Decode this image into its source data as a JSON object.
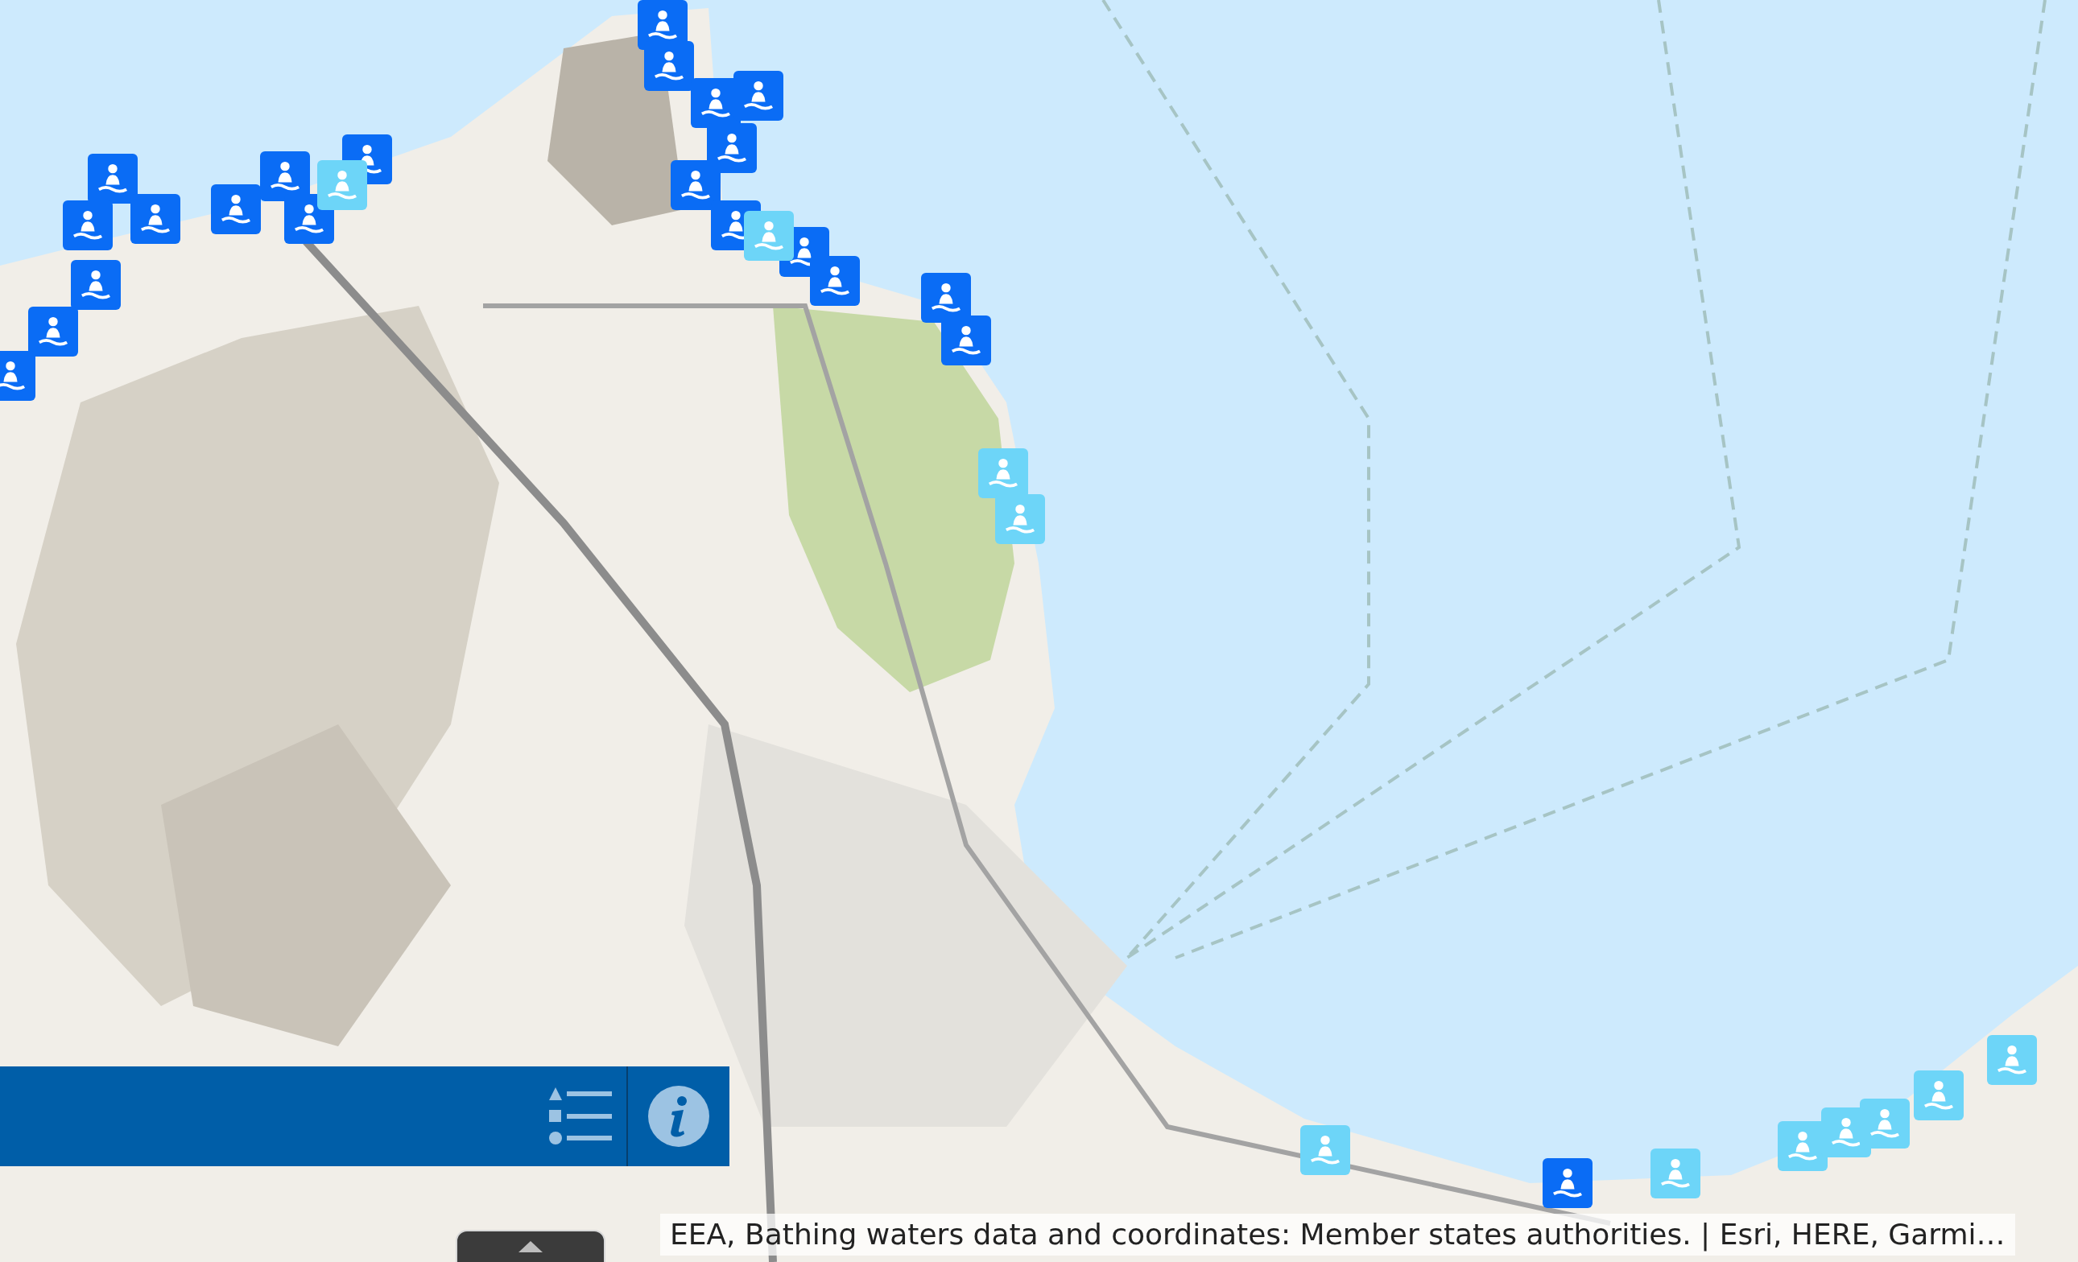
{
  "markers": [
    {
      "color": "#0a6cf5"
    },
    {
      "color": "#0a6cf5"
    },
    {
      "color": "#0a6cf5"
    },
    {
      "color": "#0a6cf5"
    },
    {
      "color": "#0a6cf5"
    },
    {
      "color": "#0a6cf5"
    },
    {
      "color": "#0a6cf5"
    },
    {
      "color": "#0a6cf5"
    },
    {
      "color": "#0a6cf5"
    },
    {
      "color": "#0a6cf5"
    },
    {
      "color": "#0a6cf5"
    },
    {
      "color": "#0a6cf5"
    },
    {
      "color": "#0a6cf5"
    },
    {
      "color": "#0a6cf5"
    },
    {
      "color": "#0a6cf5"
    },
    {
      "color": "#0a6cf5"
    },
    {
      "color": "#0a6cf5"
    },
    {
      "color": "#0a6cf5"
    },
    {
      "color": "#0a6cf5"
    },
    {
      "color": "#0a6cf5"
    },
    {
      "color": "#0a6cf5"
    },
    {
      "color": "#0a6cf5"
    },
    {
      "color": "#6dd5f8"
    },
    {
      "color": "#6dd5f8"
    },
    {
      "color": "#6dd5f8"
    },
    {
      "color": "#6dd5f8"
    },
    {
      "color": "#6dd5f8"
    },
    {
      "color": "#6dd5f8"
    },
    {
      "color": "#6dd5f8"
    },
    {
      "color": "#6dd5f8"
    },
    {
      "color": "#6dd5f8"
    },
    {
      "color": "#6dd5f8"
    },
    {
      "color": "#6dd5f8"
    }
  ],
  "attribution": "EEA, Bathing waters data and coordinates: Member states authorities. | Esri, HERE, Garmi…"
}
